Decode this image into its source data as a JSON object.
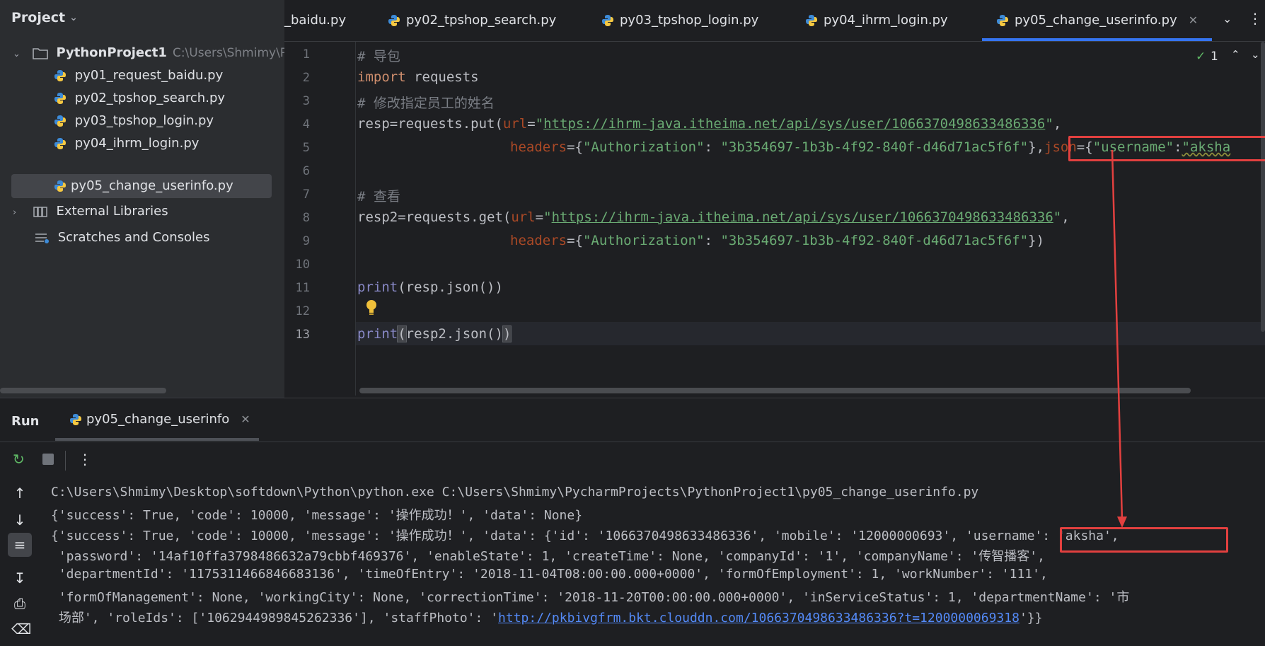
{
  "project_panel": {
    "title": "Project",
    "root": {
      "name": "PythonProject1",
      "path": "C:\\Users\\Shmimy\\Pyc"
    },
    "files": [
      {
        "name": "py01_request_baidu.py"
      },
      {
        "name": "py02_tpshop_search.py"
      },
      {
        "name": "py03_tpshop_login.py"
      },
      {
        "name": "py04_ihrm_login.py"
      },
      {
        "name": "py05_change_userinfo.py",
        "selected": true
      }
    ],
    "external_libraries": "External Libraries",
    "scratches": "Scratches and Consoles"
  },
  "editor": {
    "tabs": [
      {
        "label": "_baidu.py"
      },
      {
        "label": "py02_tpshop_search.py"
      },
      {
        "label": "py03_tpshop_login.py"
      },
      {
        "label": "py04_ihrm_login.py"
      },
      {
        "label": "py05_change_userinfo.py",
        "active": true
      }
    ],
    "inspection_count": "1",
    "line_numbers": [
      "1",
      "2",
      "3",
      "4",
      "5",
      "6",
      "7",
      "8",
      "9",
      "10",
      "11",
      "12",
      "13"
    ],
    "current_line": "13",
    "code": {
      "l1": "# 导包",
      "l2_kw": "import",
      "l2_rest": " requests",
      "l3": "# 修改指定员工的姓名",
      "l4_a": "resp=requests.put(",
      "l4_param": "url",
      "l4_eq": "=",
      "l4_q1": "\"",
      "l4_url": "https://ihrm-java.itheima.net/api/sys/user/1066370498633486336",
      "l4_q2": "\"",
      "l4_end": ",",
      "l5_param": "headers",
      "l5_a": "={",
      "l5_key": "\"Authorization\"",
      "l5_colon": ": ",
      "l5_val": "\"3b354697-1b3b-4f92-840f-d46d71ac5f6f\"",
      "l5_b": "},",
      "l5_json": "json",
      "l5_c": "={",
      "l5_ukey": "\"username\"",
      "l5_colon2": ":",
      "l5_uval": "\"aksha",
      "l7": "# 查看",
      "l8_a": "resp2=requests.get(",
      "l8_param": "url",
      "l8_eq": "=",
      "l8_q1": "\"",
      "l8_url": "https://ihrm-java.itheima.net/api/sys/user/1066370498633486336",
      "l8_q2": "\"",
      "l8_end": ",",
      "l9_param": "headers",
      "l9_a": "={",
      "l9_key": "\"Authorization\"",
      "l9_colon": ": ",
      "l9_val": "\"3b354697-1b3b-4f92-840f-d46d71ac5f6f\"",
      "l9_b": "})",
      "l11_fn": "print",
      "l11_rest": "(resp.json())",
      "l13_fn": "print",
      "l13_open": "(",
      "l13_mid": "resp2.json()",
      "l13_close": ")"
    }
  },
  "run_panel": {
    "title": "Run",
    "tab_label": "py05_change_userinfo",
    "console_lines": [
      "C:\\Users\\Shmimy\\Desktop\\softdown\\Python\\python.exe C:\\Users\\Shmimy\\PycharmProjects\\PythonProject1\\py05_change_userinfo.py",
      "{'success': True, 'code': 10000, 'message': '操作成功！', 'data': None}",
      "{'success': True, 'code': 10000, 'message': '操作成功！', 'data': {'id': '1066370498633486336', 'mobile': '12000000693', 'username': 'aksha',",
      " 'password': '14af10ffa3798486632a79cbbf469376', 'enableState': 1, 'createTime': None, 'companyId': '1', 'companyName': '传智播客',",
      " 'departmentId': '1175311466846683136', 'timeOfEntry': '2018-11-04T08:00:00.000+0000', 'formOfEmployment': 1, 'workNumber': '111',",
      " 'formOfManagement': None, 'workingCity': None, 'correctionTime': '2018-11-20T00:00:00.000+0000', 'inServiceStatus': 1, 'departmentName': '市",
      " 场部', 'roleIds': ['1062944989845262336'], 'staffPhoto': '"
    ],
    "photo_link": "http://pkbivgfrm.bkt.clouddn.com/1066370498633486336?t=1200000069318",
    "last_line_tail": "'}}"
  },
  "colors": {
    "accent": "#3574f0",
    "annotation": "#e2403f",
    "string": "#6aab73",
    "keyword": "#cf8e6d",
    "param": "#aa4926"
  }
}
